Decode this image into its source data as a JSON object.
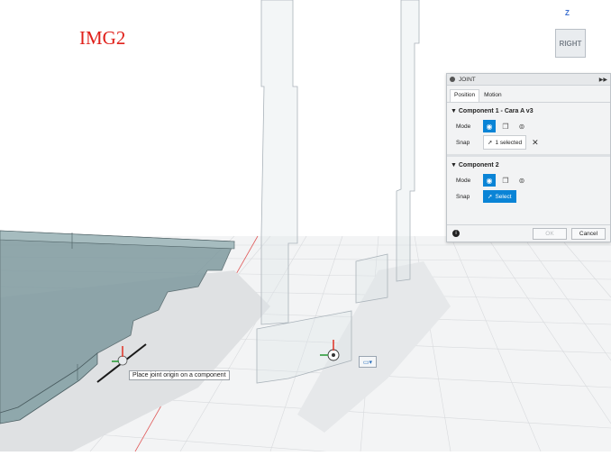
{
  "overlay": {
    "img_label": "IMG2"
  },
  "viewcube": {
    "face_label": "RIGHT",
    "axis_label": "Z"
  },
  "tooltip": {
    "text": "Place joint origin on a component"
  },
  "joint_panel": {
    "title": "JOINT",
    "tabs": [
      "Position",
      "Motion"
    ],
    "component1": {
      "header": "Component 1 - Cara A v3",
      "mode_label": "Mode",
      "snap_label": "Snap",
      "snap_value": "1 selected"
    },
    "component2": {
      "header": "Component 2",
      "mode_label": "Mode",
      "snap_label": "Snap",
      "select_label": "Select"
    },
    "ok_label": "OK",
    "cancel_label": "Cancel"
  },
  "colors": {
    "accent": "#0a84d6",
    "img_label": "#e0201a",
    "board_fill": "#7f9a9f"
  }
}
